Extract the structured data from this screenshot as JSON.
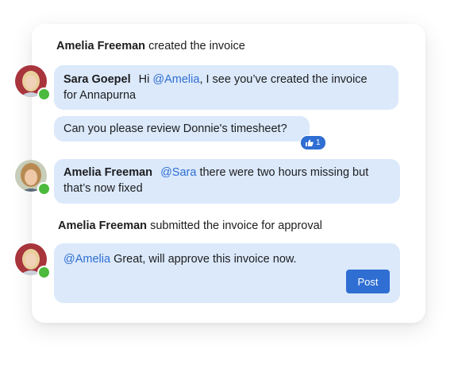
{
  "activity": {
    "event1": {
      "actor": "Amelia Freeman",
      "action": "created the invoice"
    },
    "message1": {
      "author": "Sara Goepel",
      "pre": "Hi",
      "mention": "@Amelia",
      "text_line1": ", I see you’ve created the invoice",
      "text_line2": "for Annapurna"
    },
    "message2": {
      "text": "Can you please review Donnie's timesheet?",
      "reaction": {
        "icon": "thumbs-up-icon",
        "count": "1"
      }
    },
    "message3": {
      "author": "Amelia Freeman",
      "mention": "@Sara",
      "text_line1": "there were two hours missing but",
      "text_line2": "that’s now fixed"
    },
    "event2": {
      "actor": "Amelia Freeman",
      "action": "submitted the invoice for approval"
    }
  },
  "composer": {
    "mention": "@Amelia",
    "text": "Great, will approve this invoice now.",
    "post_label": "Post"
  },
  "colors": {
    "bubble": "#dbe9fb",
    "accent": "#2f6ed3",
    "presence": "#4cba3c"
  }
}
